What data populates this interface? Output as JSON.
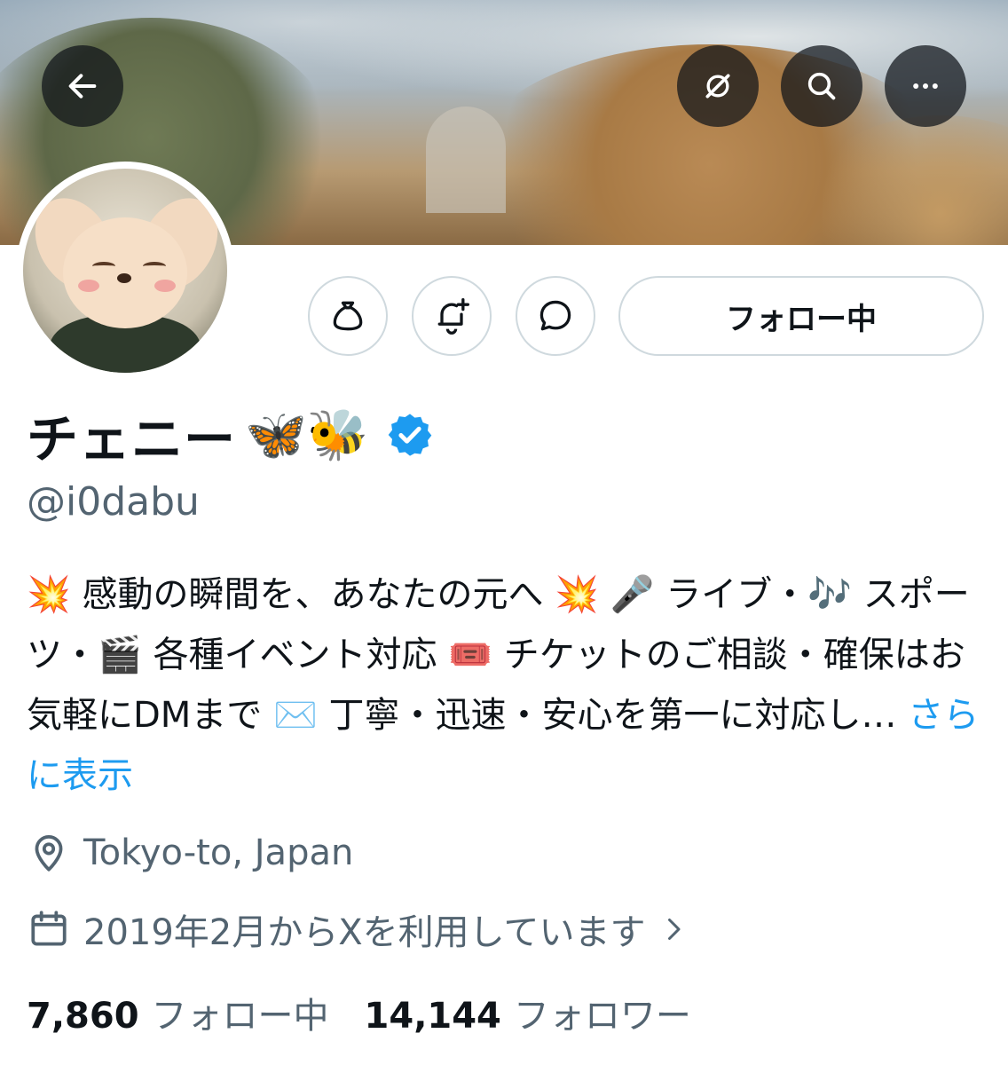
{
  "header": {
    "back_icon": "back-arrow-icon",
    "hide_icon": "eye-off-icon",
    "search_icon": "search-icon",
    "more_icon": "more-icon"
  },
  "profile": {
    "display_name": "チェニー",
    "name_emojis": "🦋🐝",
    "verified": true,
    "handle": "@i0dabu",
    "follow_button": "フォロー中",
    "bio": "💥 感動の瞬間を、あなたの元へ 💥 🎤 ライブ・🎶 スポーツ・🎬 各種イベント対応 🎟️ チケットのご相談・確保はお気軽にDMまで ✉️ 丁寧・迅速・安心を第一に対応し…",
    "bio_more": "さらに表示",
    "location": "Tokyo-to, Japan",
    "joined": "2019年2月からXを利用しています"
  },
  "stats": {
    "following_count": "7,860",
    "following_label": "フォロー中",
    "followers_count": "14,144",
    "followers_label": "フォロワー"
  },
  "colors": {
    "link": "#1d9bf0",
    "secondary_text": "#536471",
    "border": "#cfd9de",
    "verified": "#1d9bf0"
  }
}
